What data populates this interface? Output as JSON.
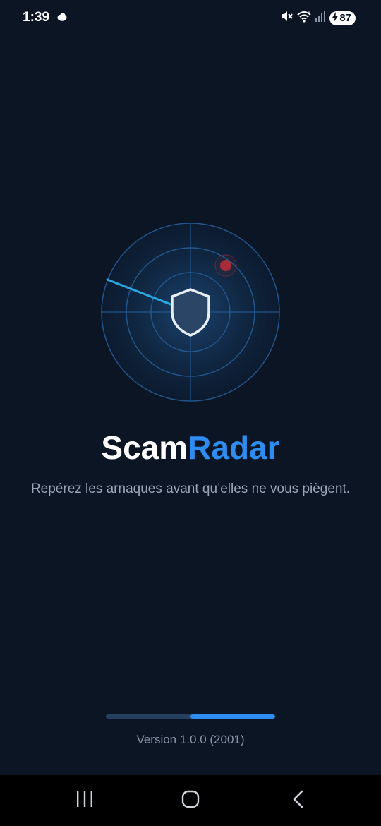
{
  "status_bar": {
    "time": "1:39",
    "battery": "87",
    "icons": [
      "cloud-icon",
      "mute-icon",
      "wifi-icon",
      "signal-icon",
      "battery-charging-icon"
    ]
  },
  "app": {
    "title_part1": "Scam",
    "title_part2": "Radar",
    "tagline": "Repérez les arnaques avant qu’elles ne vous piègent.",
    "version": "Version 1.0.0 (2001)",
    "loading_progress": 0.5
  },
  "nav_bar": {
    "icons": [
      "recent-apps-icon",
      "home-icon",
      "back-icon"
    ]
  },
  "colors": {
    "background": "#0b1524",
    "accent": "#2f8cf0",
    "radar_sweep": "#2aa6e0",
    "blip": "#b0303a"
  }
}
